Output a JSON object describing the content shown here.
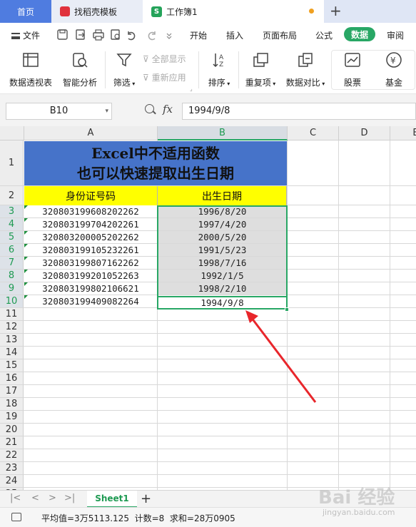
{
  "tabs": {
    "home": "首页",
    "template": "找稻壳模板",
    "workbook": "工作簿1",
    "workbook_icon": "S"
  },
  "menu": {
    "file": "文件",
    "items": [
      "开始",
      "插入",
      "页面布局",
      "公式",
      "数据",
      "审阅"
    ],
    "active": "数据"
  },
  "ribbon": {
    "pivot": "数据透视表",
    "smart": "智能分析",
    "filter": "筛选",
    "show_all": "全部显示",
    "reapply": "重新应用",
    "sort": "排序",
    "duplicates": "重复项",
    "compare": "数据对比",
    "stock": "股票",
    "fund": "基金"
  },
  "formula_bar": {
    "name_box": "B10",
    "fx": "fx",
    "value": "1994/9/8"
  },
  "columns": [
    "A",
    "B",
    "C",
    "D",
    "E"
  ],
  "selected_column": "B",
  "rows": [
    "1",
    "2",
    "3",
    "4",
    "5",
    "6",
    "7",
    "8",
    "9",
    "10",
    "11",
    "12",
    "13",
    "14",
    "15",
    "16",
    "17",
    "18",
    "19",
    "20",
    "21",
    "22",
    "23",
    "24",
    "25"
  ],
  "title_lines": [
    "Excel中不适用函数",
    "也可以快速提取出生日期"
  ],
  "headers": {
    "a": "身份证号码",
    "b": "出生日期"
  },
  "data_rows": [
    {
      "id": "320803199608202262",
      "birth": "1996/8/20"
    },
    {
      "id": "320803199704202261",
      "birth": "1997/4/20"
    },
    {
      "id": "320803200005202262",
      "birth": "2000/5/20"
    },
    {
      "id": "320803199105232261",
      "birth": "1991/5/23"
    },
    {
      "id": "320803199807162262",
      "birth": "1998/7/16"
    },
    {
      "id": "320803199201052263",
      "birth": "1992/1/5"
    },
    {
      "id": "320803199802106621",
      "birth": "1998/2/10"
    },
    {
      "id": "320803199409082264",
      "birth": "1994/9/8"
    }
  ],
  "sheet": {
    "name": "Sheet1",
    "add": "+"
  },
  "status": {
    "summary": "平均值=3万5113.125  计数=8  求和=28万0905"
  },
  "watermark": {
    "main": "Bai 经验",
    "sub": "jingyan.baidu.com"
  },
  "colors": {
    "accent_green": "#28a765",
    "title_fill": "#4673c9",
    "header_fill": "#ffff00",
    "arrow": "#e8262b"
  }
}
